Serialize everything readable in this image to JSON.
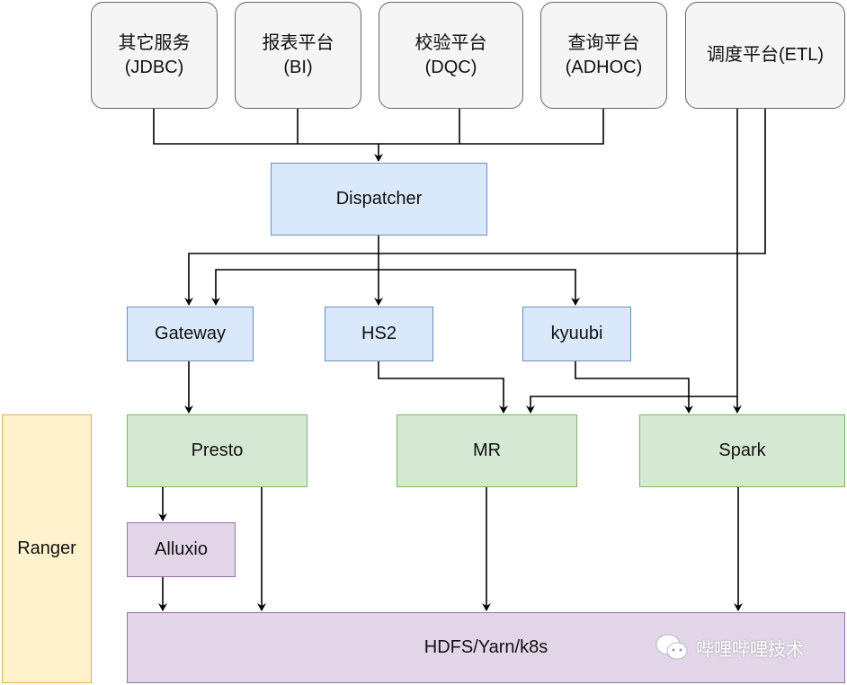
{
  "sources": [
    {
      "label": "其它服务\n(JDBC)"
    },
    {
      "label": "报表平台\n(BI)"
    },
    {
      "label": "校验平台\n(DQC)"
    },
    {
      "label": "查询平台\n(ADHOC)"
    },
    {
      "label": "调度平台(ETL)"
    }
  ],
  "dispatcher": "Dispatcher",
  "gateways": {
    "gateway": "Gateway",
    "hs2": "HS2",
    "kyuubi": "kyuubi"
  },
  "engines": {
    "presto": "Presto",
    "mr": "MR",
    "spark": "Spark"
  },
  "alluxio": "Alluxio",
  "ranger": "Ranger",
  "storage": "HDFS/Yarn/k8s",
  "watermark": "哔哩哔哩技术",
  "colors": {
    "gray": "#f5f5f5",
    "blue": "#dae8fc",
    "green": "#d5e8d4",
    "purple": "#e1d5e7",
    "yellow": "#fff2cc"
  }
}
